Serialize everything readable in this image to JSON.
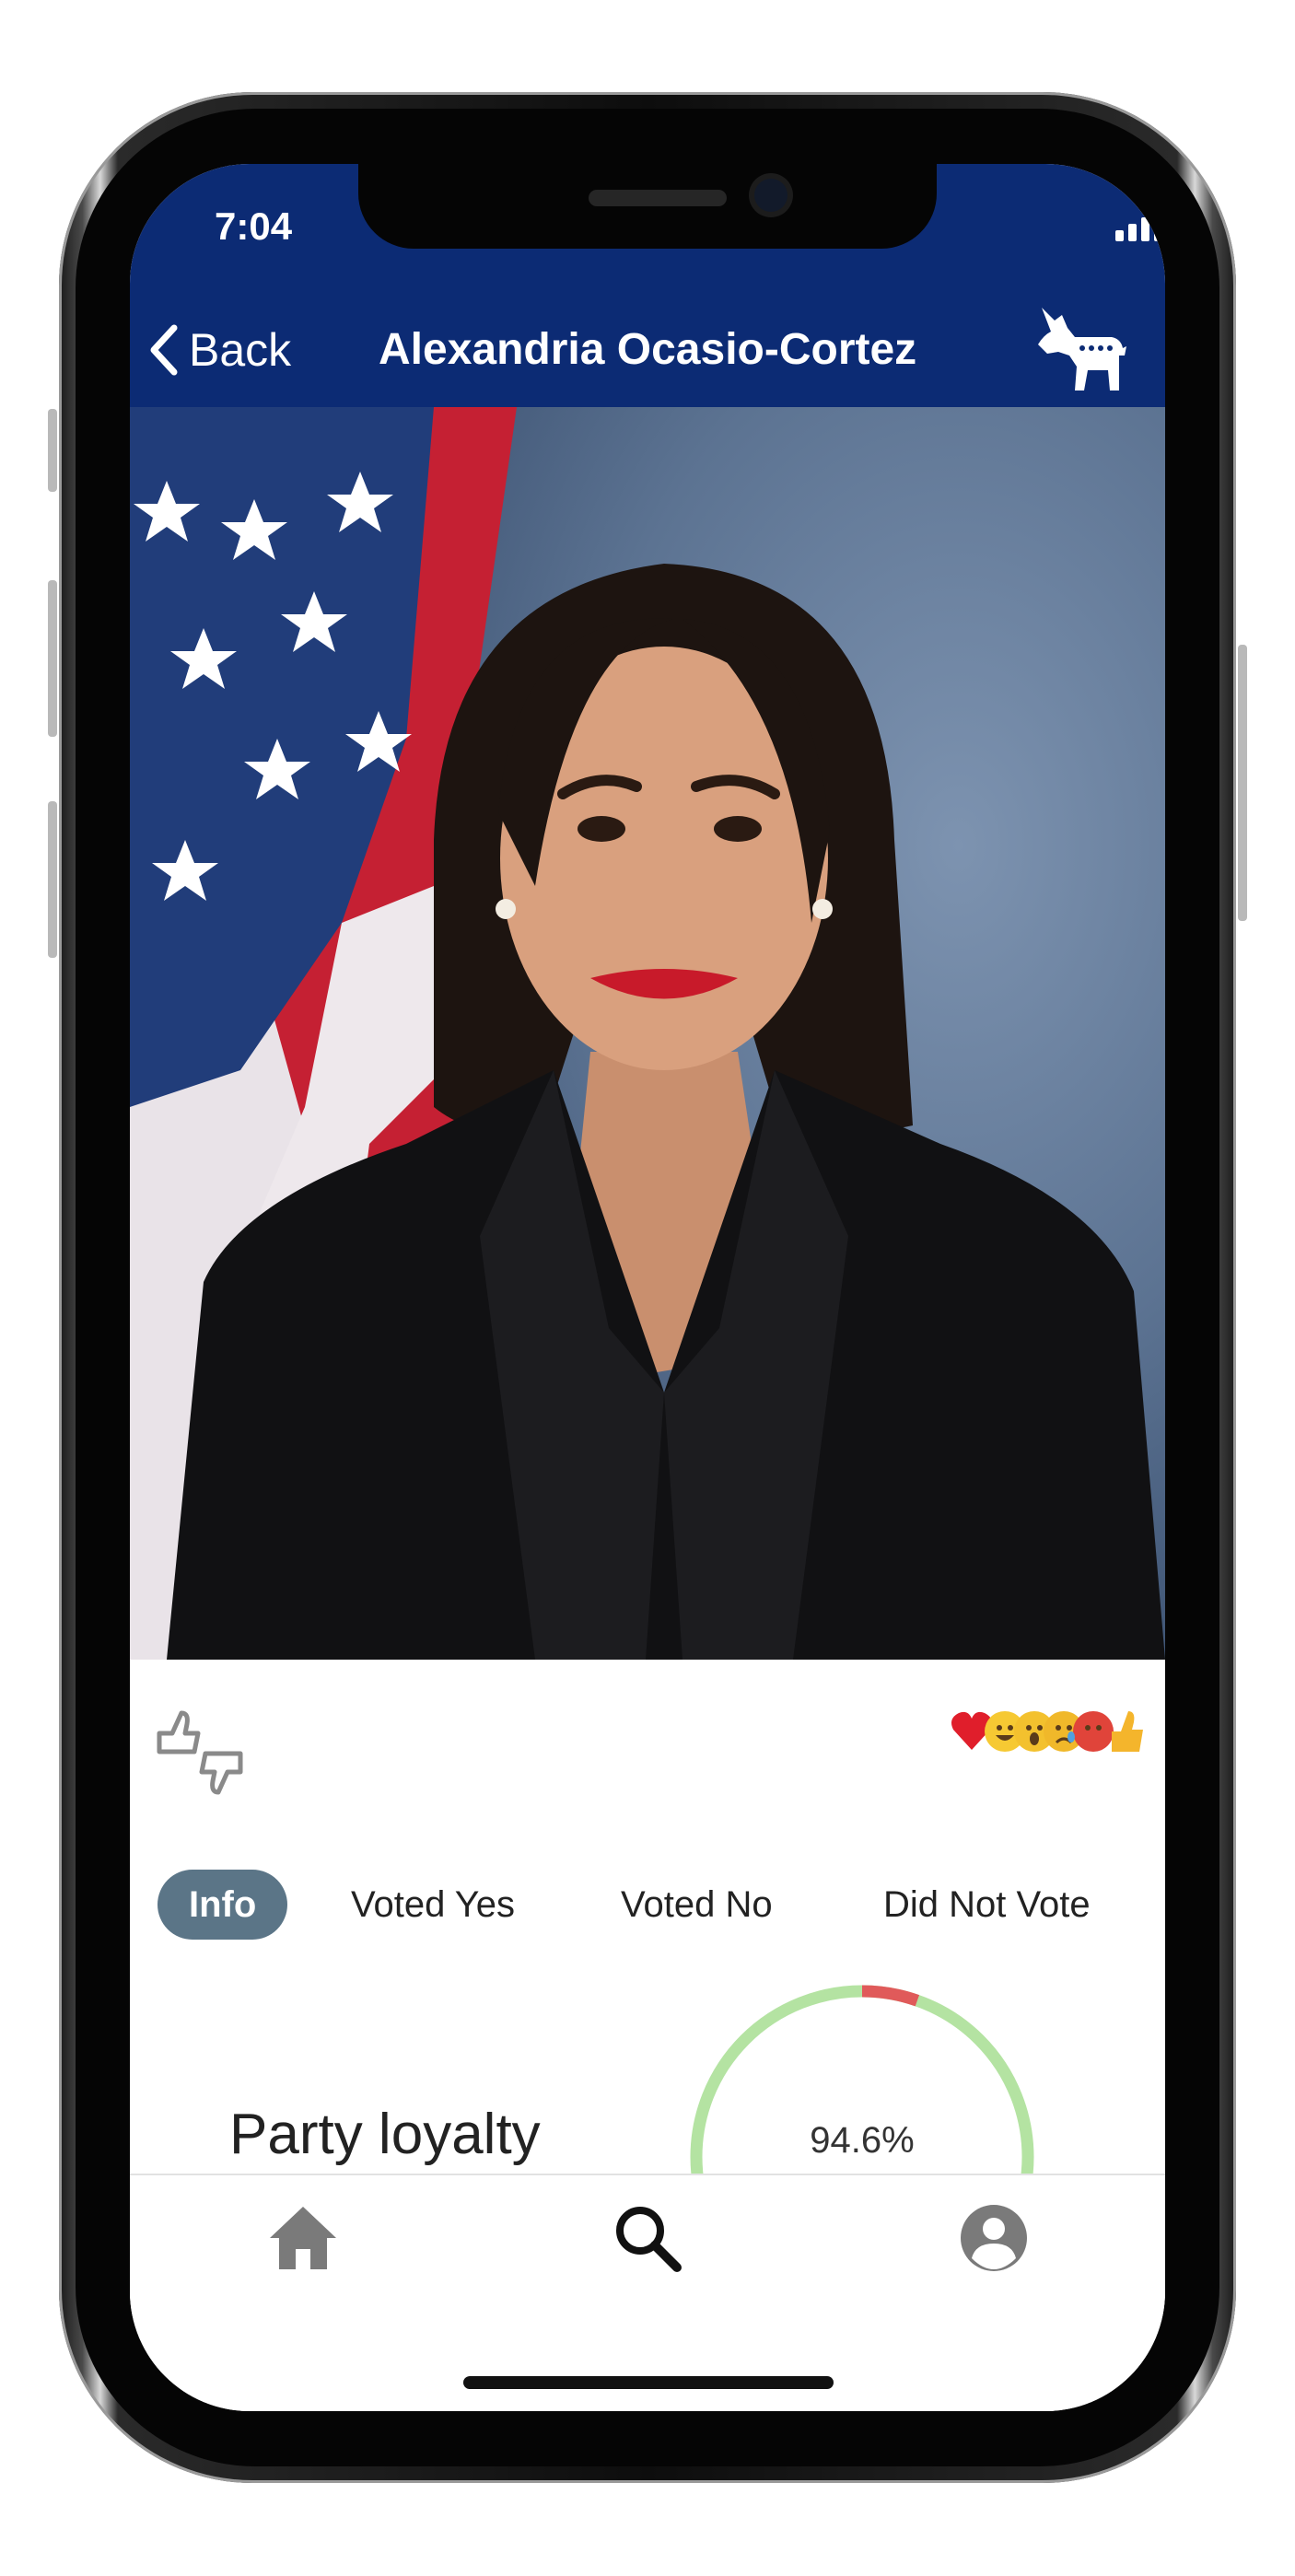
{
  "status_bar": {
    "time": "7:04"
  },
  "header": {
    "back_label": "Back",
    "title": "Alexandria Ocasio-Cortez",
    "party_icon": "democratic-donkey-icon",
    "background_color": "#0c2b74"
  },
  "portrait": {
    "description_icon": "portrait-photo"
  },
  "card": {
    "vote_icon": "thumbs-up-down-icon",
    "reactions": [
      "heart",
      "laughing",
      "surprised",
      "crying",
      "angry",
      "thumbs-up"
    ],
    "tabs": [
      {
        "label": "Info",
        "active": true
      },
      {
        "label": "Voted Yes",
        "active": false
      },
      {
        "label": "Voted No",
        "active": false
      },
      {
        "label": "Did Not Vote",
        "active": false
      }
    ],
    "loyalty": {
      "label": "Party loyalty",
      "value_text": "94.6%",
      "value": 0.946,
      "loyal_color": "#b4e3a2",
      "disloyal_color": "#e05a5a"
    }
  },
  "tabbar": {
    "items": [
      {
        "icon": "home-icon",
        "active": false
      },
      {
        "icon": "search-icon",
        "active": true
      },
      {
        "icon": "profile-icon",
        "active": false
      }
    ]
  }
}
